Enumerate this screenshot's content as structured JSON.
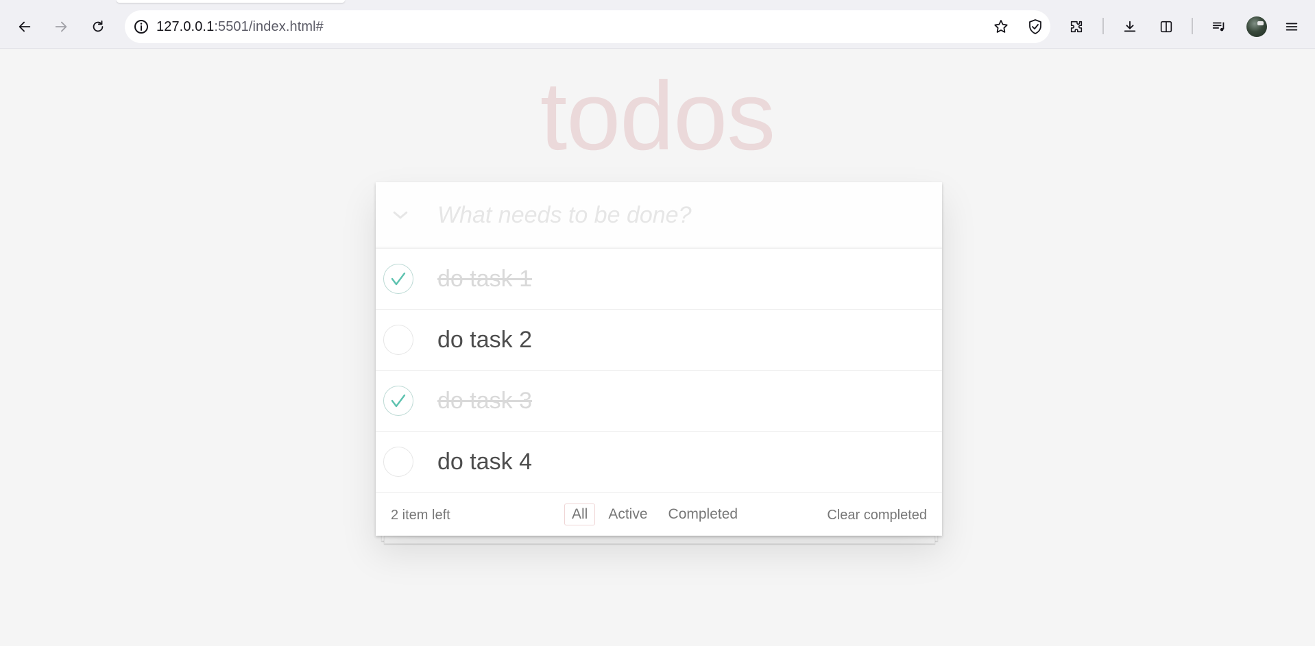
{
  "browser": {
    "url_host": "127.0.0.1",
    "url_path": ":5501/index.html#"
  },
  "app": {
    "title": "todos",
    "new_todo_placeholder": "What needs to be done?"
  },
  "todos": [
    {
      "label": "do task 1",
      "completed": true
    },
    {
      "label": "do task 2",
      "completed": false
    },
    {
      "label": "do task 3",
      "completed": true
    },
    {
      "label": "do task 4",
      "completed": false
    }
  ],
  "footer": {
    "count_text": "2 item left",
    "filters": [
      "All",
      "Active",
      "Completed"
    ],
    "selected_filter": "All",
    "clear_completed": "Clear completed"
  },
  "colors": {
    "check_green": "#5dc2af",
    "title": "#b83f45"
  }
}
